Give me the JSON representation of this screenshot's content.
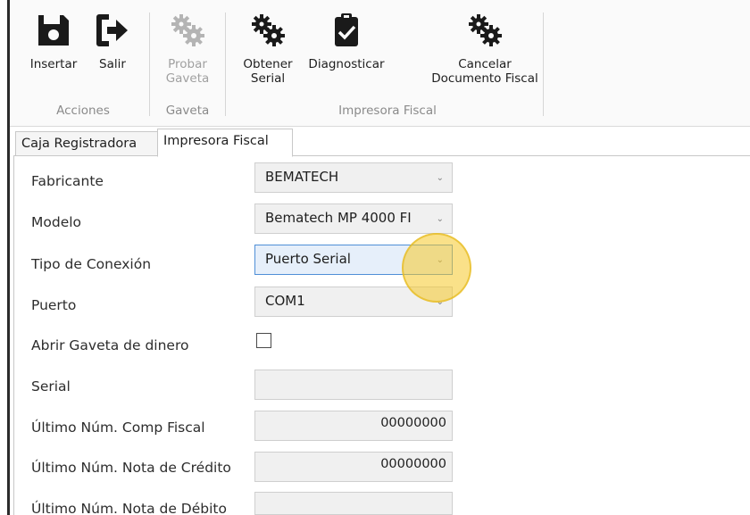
{
  "ribbon": {
    "buttons": [
      {
        "label": "Insertar",
        "icon": "floppy-disk-icon"
      },
      {
        "label": "Salir",
        "icon": "exit-arrow-icon"
      },
      {
        "label": "Probar\nGaveta",
        "icon": "gears-icon"
      },
      {
        "label": "Obtener\nSerial",
        "icon": "gears-icon"
      },
      {
        "label": "Diagnosticar",
        "icon": "clipboard-check-icon"
      },
      {
        "label": "Cancelar\nDocumento Fiscal",
        "icon": "gears-icon"
      }
    ],
    "groups": [
      "Acciones",
      "Gaveta",
      "Impresora Fiscal"
    ]
  },
  "tabs": [
    {
      "label": "Caja Registradora",
      "active": false
    },
    {
      "label": "Impresora Fiscal",
      "active": true
    }
  ],
  "form": {
    "fabricante": {
      "label": "Fabricante",
      "value": "BEMATECH"
    },
    "modelo": {
      "label": "Modelo",
      "value": "Bematech MP 4000 FI"
    },
    "tipo_conexion": {
      "label": "Tipo de Conexión",
      "value": "Puerto Serial"
    },
    "puerto": {
      "label": "Puerto",
      "value": "COM1"
    },
    "abrir_gaveta": {
      "label": "Abrir Gaveta de dinero",
      "checked": false
    },
    "serial": {
      "label": "Serial",
      "value": ""
    },
    "ultimo_comp_fiscal": {
      "label": "Último Núm. Comp Fiscal",
      "value": "00000000"
    },
    "ultimo_nota_credito": {
      "label": "Último Núm. Nota de Crédito",
      "value": "00000000"
    },
    "ultimo_nota_debito": {
      "label": "Último Núm. Nota de Débito",
      "value": ""
    }
  },
  "colors": {
    "icon_active": "#1a1a1a",
    "icon_disabled": "#b4b4b4",
    "focus_border": "#4f8fd7",
    "cursor_highlight": "#f5c828"
  }
}
